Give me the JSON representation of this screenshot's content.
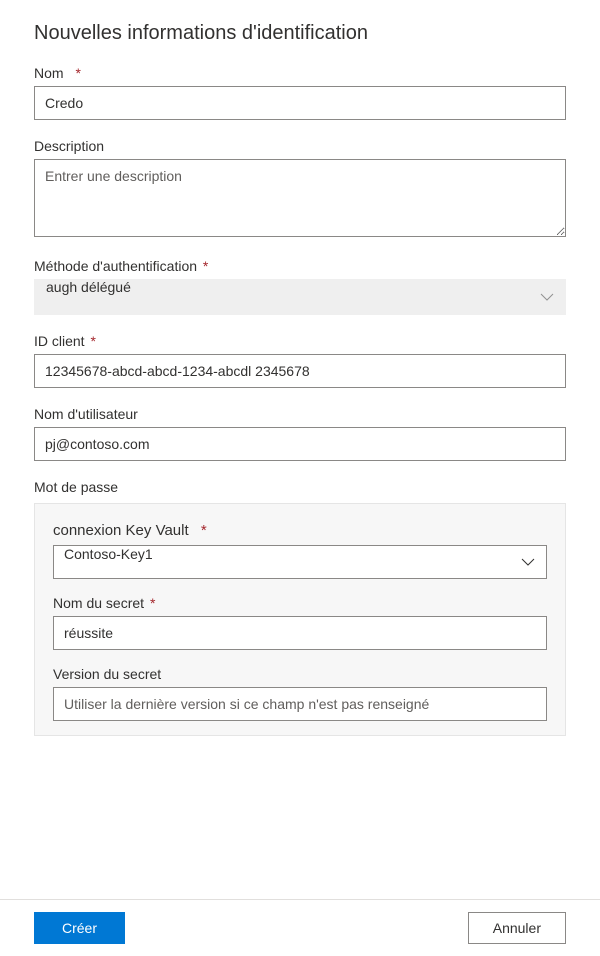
{
  "title": "Nouvelles informations d'identification",
  "fields": {
    "name": {
      "label": "Nom",
      "value": "Credo",
      "required": true
    },
    "description": {
      "label": "Description",
      "placeholder": "Entrer une description",
      "value": ""
    },
    "authMethod": {
      "label": "Méthode d'authentification",
      "value": "augh délégué",
      "required": true
    },
    "clientId": {
      "label": "ID client",
      "value": "12345678-abcd-abcd-1234-abcdl 2345678",
      "required": true
    },
    "username": {
      "label": "Nom d'utilisateur",
      "value": "pj@contoso.com"
    },
    "password": {
      "label": "Mot de passe",
      "keyVaultConnection": {
        "label": "connexion Key Vault",
        "value": "Contoso-Key1",
        "required": true
      },
      "secretName": {
        "label": "Nom du secret",
        "value": "réussite",
        "required": true
      },
      "secretVersion": {
        "label": "Version du secret",
        "placeholder": "Utiliser la dernière version si ce champ n'est pas renseigné",
        "value": ""
      }
    }
  },
  "buttons": {
    "create": "Créer",
    "cancel": "Annuler"
  }
}
